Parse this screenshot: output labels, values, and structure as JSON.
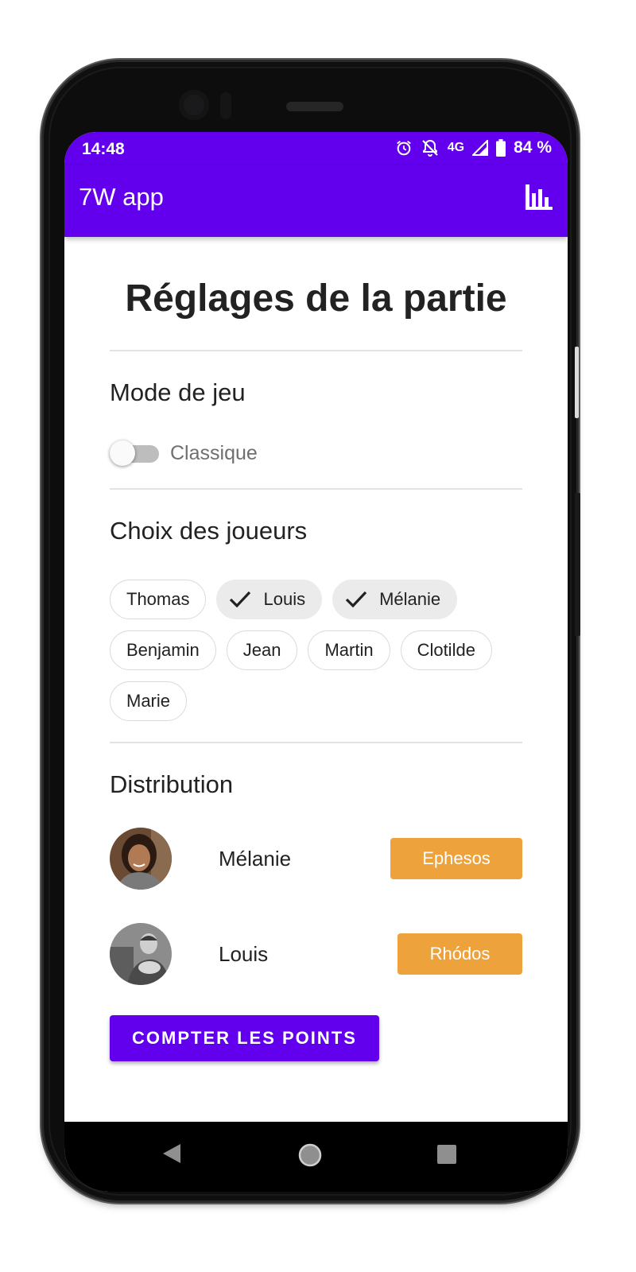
{
  "status_bar": {
    "time": "14:48",
    "network": "4G",
    "battery": "84 %",
    "icons": [
      "alarm-icon",
      "notifications-off-icon",
      "signal-icon",
      "battery-icon"
    ]
  },
  "app_bar": {
    "title": "7W app",
    "action_icon": "bar-chart-icon"
  },
  "page": {
    "title": "Réglages de la partie"
  },
  "game_mode": {
    "heading": "Mode de jeu",
    "switch_label": "Classique",
    "switch_on": false
  },
  "players": {
    "heading": "Choix des joueurs",
    "chips": [
      {
        "label": "Thomas",
        "selected": false
      },
      {
        "label": "Louis",
        "selected": true
      },
      {
        "label": "Mélanie",
        "selected": true
      },
      {
        "label": "Benjamin",
        "selected": false
      },
      {
        "label": "Jean",
        "selected": false
      },
      {
        "label": "Martin",
        "selected": false
      },
      {
        "label": "Clotilde",
        "selected": false
      },
      {
        "label": "Marie",
        "selected": false
      }
    ]
  },
  "distribution": {
    "heading": "Distribution",
    "rows": [
      {
        "name": "Mélanie",
        "wonder": "Ephesos"
      },
      {
        "name": "Louis",
        "wonder": "Rhódos"
      }
    ]
  },
  "actions": {
    "count_points": "COMPTER LES POINTS"
  },
  "colors": {
    "primary": "#6200ee",
    "wonder_badge": "#eda23b"
  },
  "nav_bar": {
    "icons": [
      "back-icon",
      "home-icon",
      "recents-icon"
    ]
  }
}
